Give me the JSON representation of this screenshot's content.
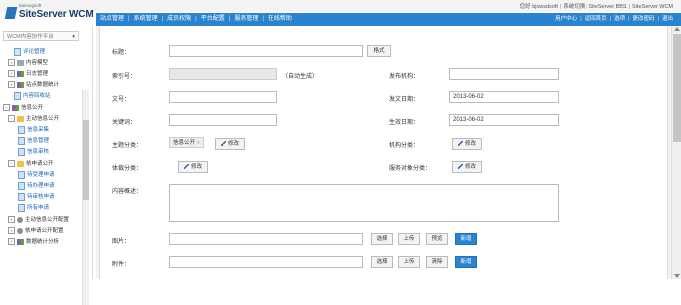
{
  "header": {
    "logo_small": "bairongsoft",
    "logo_main": "SiteServer WCM",
    "top_links": [
      "您好 bjxwsdsoft",
      "系统切换: SiteServer BBS",
      "SiteServer WCM"
    ]
  },
  "nav": {
    "items": [
      "站点管理",
      "系统管理",
      "成员权限",
      "平台配置",
      "服务管理",
      "在线帮助"
    ],
    "right_links": [
      "用户中心",
      "返回首页",
      "选项",
      "更改密码",
      "退出"
    ]
  },
  "sidebar": {
    "site_select": "WCM内容协作平台",
    "tree": [
      {
        "label": "评论管理",
        "type": "link"
      },
      {
        "label": "内容模型",
        "type": "node"
      },
      {
        "label": "日志管理",
        "type": "node"
      },
      {
        "label": "站点数据统计",
        "type": "node"
      },
      {
        "label": "内容回收站",
        "type": "link"
      },
      {
        "label": "信息公开",
        "type": "node"
      },
      {
        "label": "主动信息公开",
        "type": "node"
      },
      {
        "label": "信息采集",
        "type": "link"
      },
      {
        "label": "信息管理",
        "type": "link"
      },
      {
        "label": "信息审核",
        "type": "link"
      },
      {
        "label": "依申请公开",
        "type": "node"
      },
      {
        "label": "待受理申请",
        "type": "link"
      },
      {
        "label": "待办理申请",
        "type": "link"
      },
      {
        "label": "待审核申请",
        "type": "link"
      },
      {
        "label": "所有申请",
        "type": "link"
      },
      {
        "label": "主动信息公开配置",
        "type": "node"
      },
      {
        "label": "依申请公开配置",
        "type": "node"
      },
      {
        "label": "数据统计分析",
        "type": "node"
      }
    ]
  },
  "form": {
    "title_label": "标题：",
    "style_button": "格式",
    "index_label": "索引号：",
    "index_hint": "（自动生成）",
    "publisher_label": "发布机构：",
    "docno_label": "文号：",
    "pubdate_label": "发文日期：",
    "pubdate_value": "2013-06-02",
    "keywords_label": "关键词：",
    "effdate_label": "生效日期：",
    "effdate_value": "2013-06-02",
    "topic_label": "主题分类：",
    "topic_tag": "信息公开",
    "topic_tag_close": "×",
    "edit_label": "修改",
    "org_label": "机构分类：",
    "genre_label": "体裁分类：",
    "audience_label": "服务对象分类：",
    "summary_label": "内容概述：",
    "image_label": "图片：",
    "attach_label": "附件：",
    "btn_select": "选择",
    "btn_upload": "上传",
    "btn_preview": "预览",
    "btn_clear": "清除",
    "btn_add": "新增"
  },
  "colors": {
    "nav_blue": "#2a83cf",
    "link_blue": "#1e63b5"
  }
}
